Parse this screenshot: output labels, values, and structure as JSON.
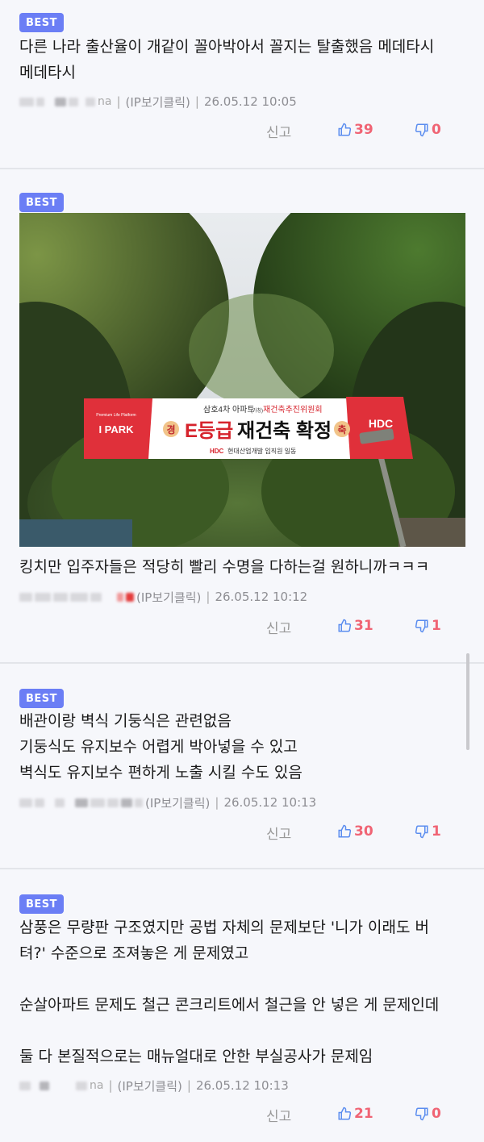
{
  "best_label": "BEST",
  "report_label": "신고",
  "ip_label": "(IP보기클릭)",
  "colors": {
    "badge": "#6b7ef5",
    "vote": "#f06474",
    "accent": "#5b8def"
  },
  "comments": [
    {
      "lines": [
        "다른 나라 출산율이 개같이 꼴아박아서 꼴지는 탈출했음 메데타시",
        "메데타시"
      ],
      "author_tail": "na",
      "timestamp": "26.05.12 10:05",
      "upvotes": "39",
      "downvotes": "0"
    },
    {
      "lines": [
        "킹치만 입주자들은 적당히 빨리 수명을 다하는걸 원하니까ㅋㅋㅋ"
      ],
      "timestamp": "26.05.12 10:12",
      "upvotes": "31",
      "downvotes": "1",
      "photo": {
        "banner_top": "삼호4차 아파트",
        "banner_top_small": "(가칭)",
        "banner_top_red": "재건축추진위원회",
        "banner_main_red": "E등급",
        "banner_main": "재건축 확정",
        "banner_sub_red": "HDC",
        "banner_sub": "현대산업개발 임직원 일동",
        "left_brand": "I PARK",
        "left_brand_small": "Premium Life Platform",
        "right_brand": "HDC",
        "badge_left": "경",
        "badge_right": "축"
      }
    },
    {
      "lines": [
        "배관이랑 벽식 기둥식은 관련없음",
        "기둥식도 유지보수 어렵게 박아넣을 수 있고",
        "벽식도 유지보수 편하게 노출 시킬 수도 있음"
      ],
      "timestamp": "26.05.12 10:13",
      "upvotes": "30",
      "downvotes": "1"
    },
    {
      "lines": [
        "삼풍은 무량판 구조였지만 공법 자체의 문제보단 '니가 이래도 버",
        "텨?' 수준으로 조져놓은 게 문제였고",
        "",
        "순살아파트 문제도 철근 콘크리트에서 철근을 안 넣은 게 문제인데",
        "",
        "둘 다 본질적으로는 매뉴얼대로 안한 부실공사가 문제임"
      ],
      "author_tail": "na",
      "timestamp": "26.05.12 10:13",
      "upvotes": "21",
      "downvotes": "0"
    }
  ]
}
